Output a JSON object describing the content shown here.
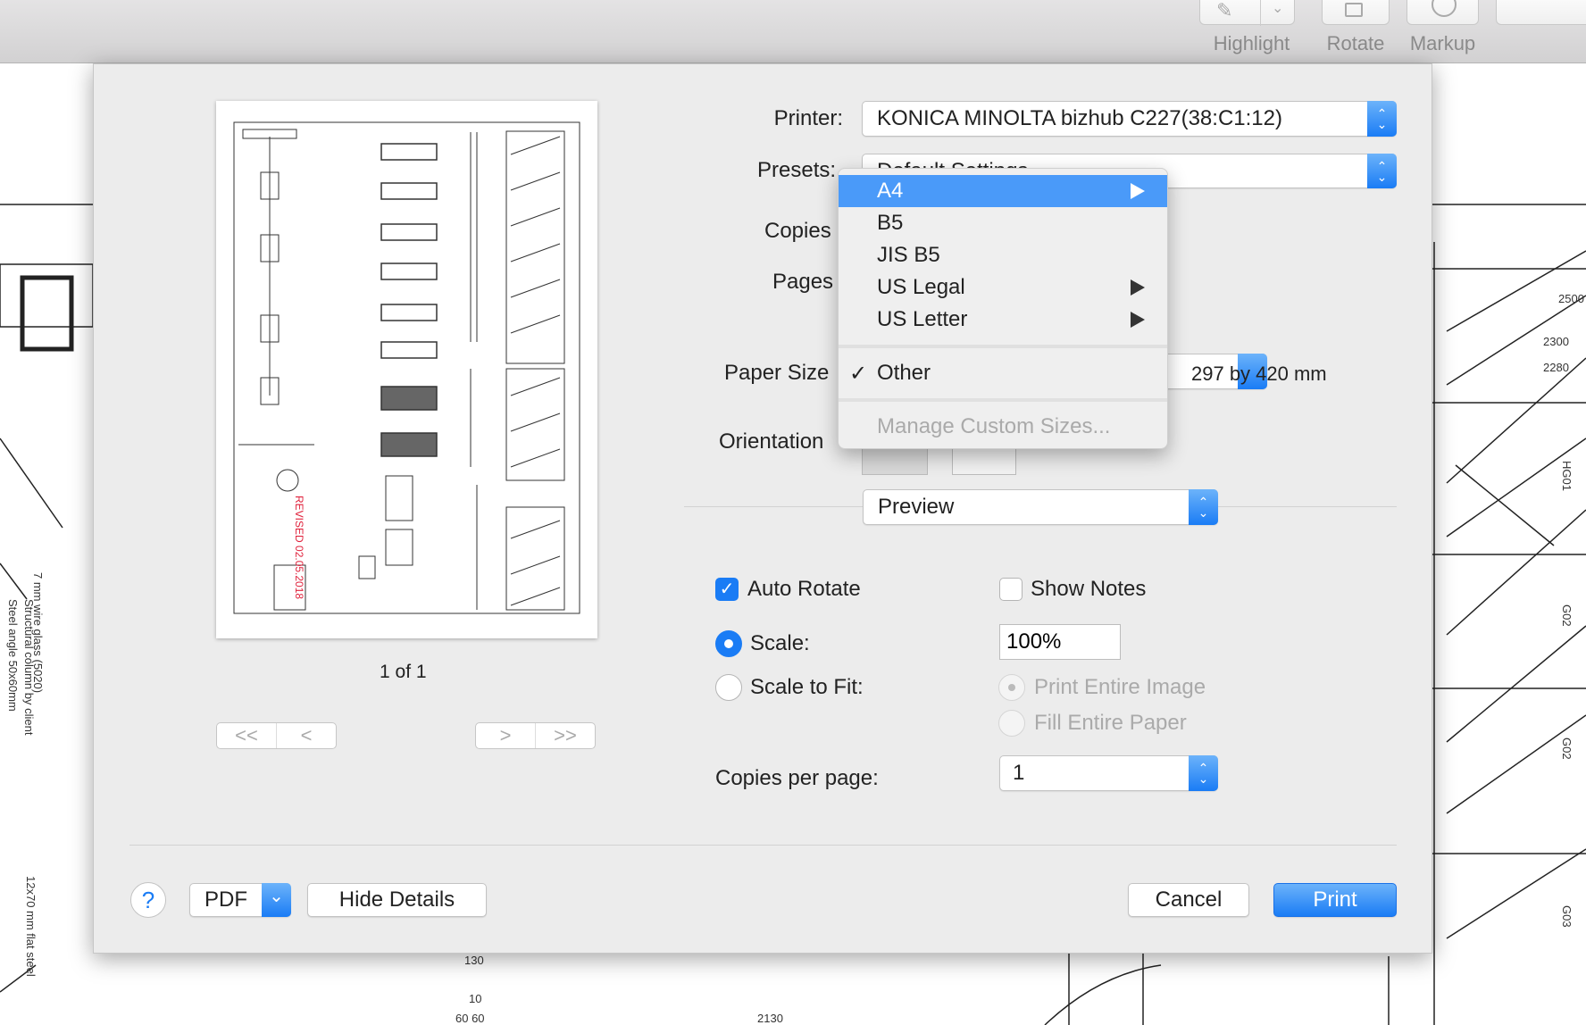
{
  "toolbar": {
    "buttons": [
      {
        "label": "Highlight",
        "icon": "highlighter-icon"
      },
      {
        "label": "Rotate",
        "icon": "rotate-icon"
      },
      {
        "label": "Markup",
        "icon": "markup-pen-icon"
      }
    ]
  },
  "background": {
    "left_labels": [
      "7 mm wire glass (5020)",
      "Structural column by client",
      "Steel angle 50x60mm",
      "12x70 mm flat steel"
    ],
    "bottom_labels": [
      "130",
      "10",
      "60 60",
      "2130"
    ],
    "right_labels": [
      "2500",
      "2300",
      "2280",
      "HG01",
      "G02",
      "G02",
      "G03"
    ]
  },
  "preview": {
    "stamp": "REVISED 02.05.2018",
    "page_indicator": "1 of 1",
    "nav": {
      "first": "<<",
      "prev": "<",
      "next": ">",
      "last": ">>"
    }
  },
  "printer": {
    "label": "Printer:",
    "value": "KONICA MINOLTA bizhub C227(38:C1:12)"
  },
  "presets": {
    "label": "Presets:",
    "value": "Default Settings"
  },
  "copies": {
    "label": "Copies"
  },
  "pages": {
    "label": "Pages"
  },
  "paper_size": {
    "label": "Paper Size",
    "dimensions": "297 by 420 mm"
  },
  "orientation": {
    "label": "Orientation"
  },
  "paper_menu": {
    "items": [
      {
        "label": "A4",
        "highlighted": true,
        "submenu": true
      },
      {
        "label": "B5"
      },
      {
        "label": "JIS B5"
      },
      {
        "label": "US Legal",
        "submenu": true
      },
      {
        "label": "US Letter",
        "submenu": true
      }
    ],
    "other": {
      "label": "Other",
      "checked": true
    },
    "manage": {
      "label": "Manage Custom Sizes...",
      "disabled": true
    }
  },
  "section": {
    "value": "Preview"
  },
  "options": {
    "auto_rotate": {
      "label": "Auto Rotate",
      "checked": true
    },
    "show_notes": {
      "label": "Show Notes",
      "checked": false
    },
    "scale": {
      "label": "Scale:",
      "selected": true,
      "value": "100%"
    },
    "scale_to_fit": {
      "label": "Scale to Fit:",
      "selected": false
    },
    "print_entire_image": {
      "label": "Print Entire Image",
      "disabled": true
    },
    "fill_entire_paper": {
      "label": "Fill Entire Paper",
      "disabled": true
    },
    "copies_per_page": {
      "label": "Copies per page:",
      "value": "1"
    }
  },
  "footer": {
    "help": "?",
    "pdf": "PDF",
    "hide_details": "Hide Details",
    "cancel": "Cancel",
    "print": "Print"
  },
  "colors": {
    "accent": "#1a7cf5",
    "menu_highlight": "#4a9af9",
    "stamp": "#e0223c"
  }
}
